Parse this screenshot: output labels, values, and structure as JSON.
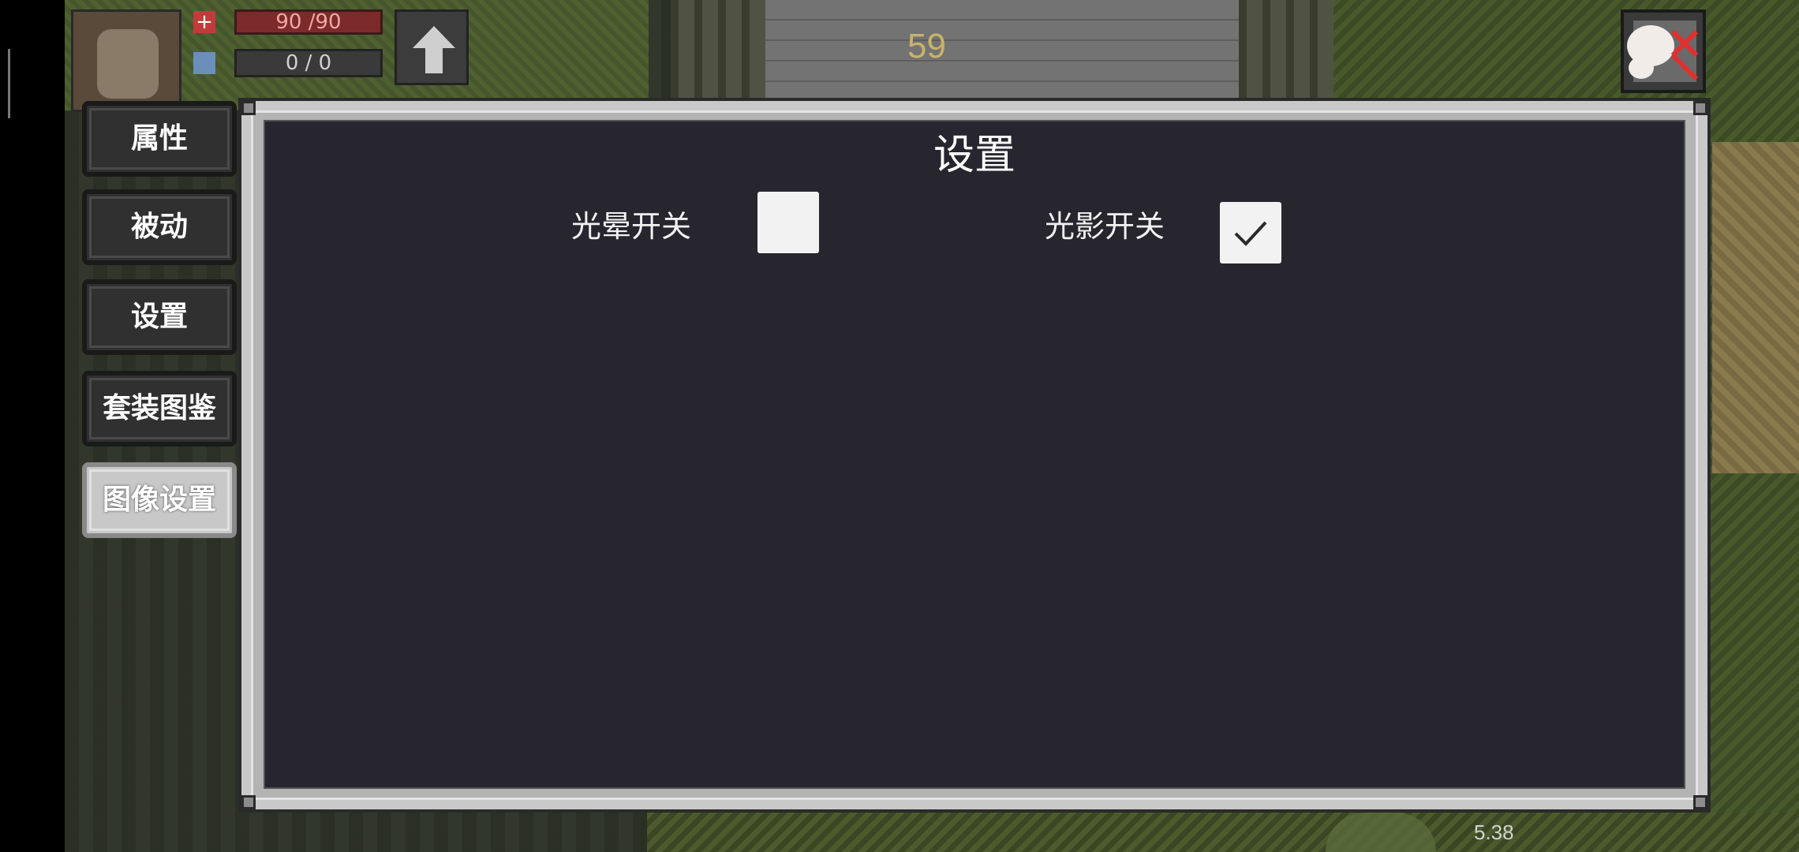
{
  "hud": {
    "hp_text": "90 /90",
    "mp_text": "0 / 0",
    "timer": "59",
    "version": "5.38"
  },
  "side_tabs": [
    {
      "label": "属性",
      "active": false
    },
    {
      "label": "被动",
      "active": false
    },
    {
      "label": "设置",
      "active": false
    },
    {
      "label": "套装图鉴",
      "active": false
    },
    {
      "label": "图像设置",
      "active": true
    }
  ],
  "panel": {
    "title": "设置",
    "options": [
      {
        "label": "光晕开关",
        "checked": false
      },
      {
        "label": "光影开关",
        "checked": true
      }
    ]
  },
  "colors": {
    "panel_bg": "#27262f",
    "hp": "#c23b3b",
    "close_x": "#e03030"
  },
  "icons": [
    "hp-cross-icon",
    "mp-shield-icon",
    "up-arrow-icon",
    "close-x-icon",
    "checkmark-icon"
  ]
}
